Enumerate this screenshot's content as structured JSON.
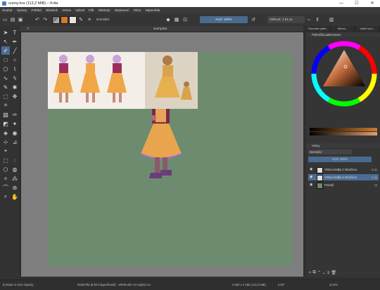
{
  "window": {
    "title": "sunny.kra (113,2 MiB)  – Krita",
    "minimize": "—",
    "maximize": "☐",
    "close": "✕"
  },
  "menu": [
    "Soubor",
    "Úpravy",
    "Pohled",
    "Obrázek",
    "Vrstva",
    "Vybrat",
    "Filtr",
    "Nástroje",
    "Nastavení",
    "Okno",
    "Nápověda"
  ],
  "toolbar": {
    "blend_mode": "Normální",
    "opacity": "Krytí: 100%",
    "size": "Velikost: 4,51 px"
  },
  "document": {
    "tab_title": "sunny.kra",
    "tab_close": "✕"
  },
  "dock": {
    "tabs": [
      "Pokročilá výběr...",
      "Mezno...",
      "Výběr kom..."
    ],
    "color_panel_title": "Pokročilá paleta barev",
    "layers_panel_title": "Vrstvy",
    "layers_blend": "Normální",
    "layers_opacity": "Krytí: 100%",
    "layers": [
      {
        "name": "Vrstva malby 2 Sloučeno",
        "selected": false
      },
      {
        "name": "Vrstva malby 6 Sloučeno",
        "selected": true
      },
      {
        "name": "Pozadí",
        "selected": false
      }
    ]
  },
  "status": {
    "brush": "b) Basic-5 Size Opacity",
    "color_info": "RGB/Alfa (8-bit integer/kanál) - sRGB-elle-V2-srgbtrc.icc",
    "dimensions": "3 500 x 2 480 (113,2 MiB)",
    "rotation": "0,00°",
    "zoom": "22,6%"
  },
  "colors": {
    "accent": "#4b6d94",
    "canvas_bg": "#6d8c6f",
    "fg_color": "#d07a2a"
  }
}
